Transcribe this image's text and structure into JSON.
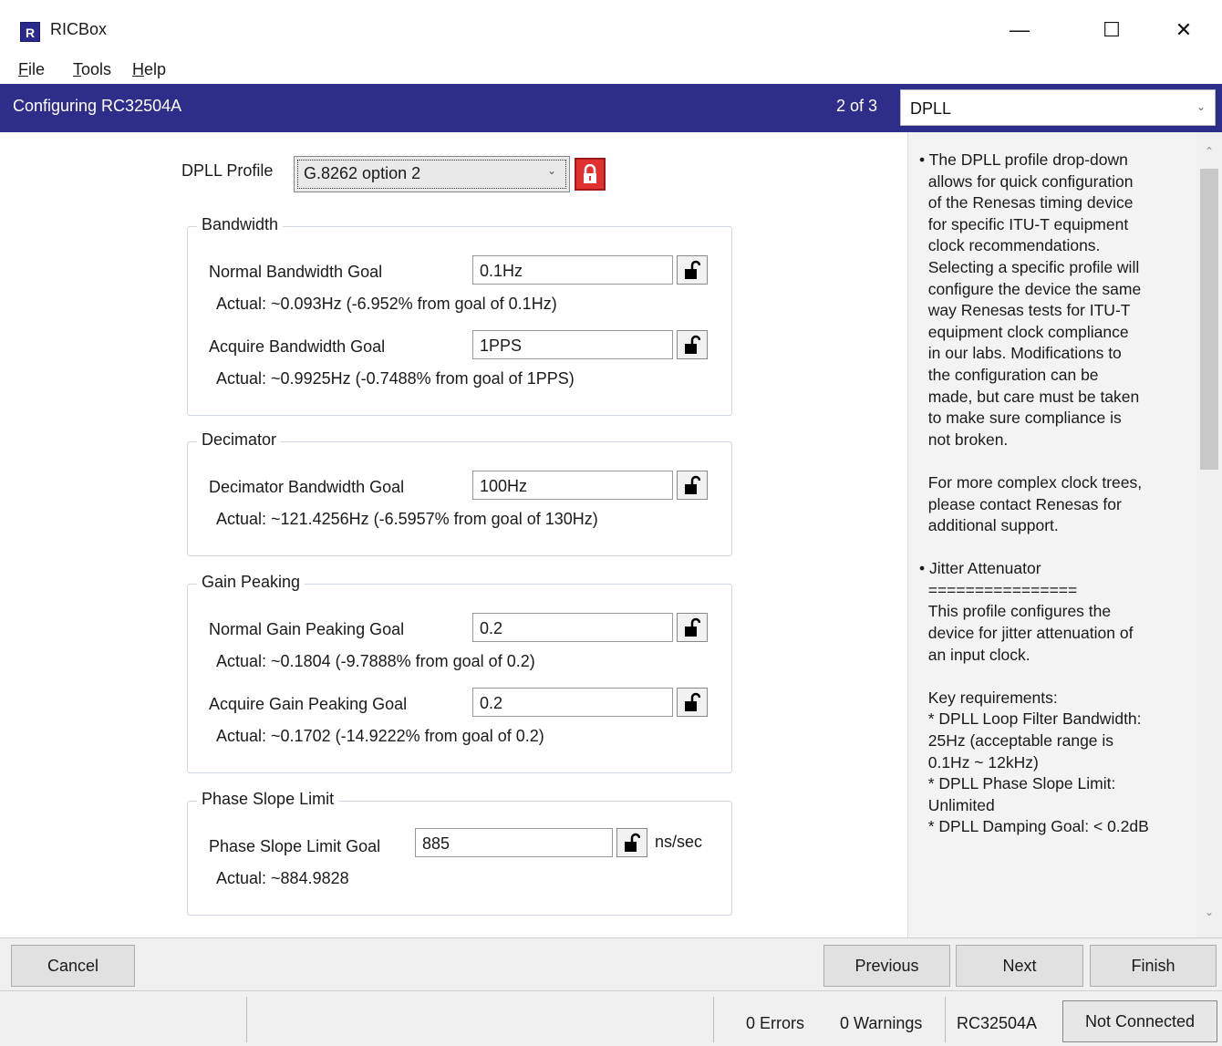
{
  "window": {
    "app_icon": "R",
    "title": "RICBox",
    "minimize": "—",
    "maximize": "☐",
    "close": "✕"
  },
  "menu": {
    "file_u": "F",
    "file_rest": "ile",
    "tools_u": "T",
    "tools_rest": "ools",
    "help_u": "H",
    "help_rest": "elp"
  },
  "header": {
    "title": "Configuring RC32504A",
    "step": "2 of 3",
    "step_select": "DPLL"
  },
  "profile": {
    "label": "DPLL Profile",
    "value": "G.8262 option 2"
  },
  "bandwidth": {
    "group": "Bandwidth",
    "normal_label": "Normal Bandwidth Goal",
    "normal_value": "0.1Hz",
    "normal_actual": "Actual:  ~0.093Hz (-6.952% from goal of 0.1Hz)",
    "acquire_label": "Acquire Bandwidth Goal",
    "acquire_value": "1PPS",
    "acquire_actual": "Actual:  ~0.9925Hz (-0.7488% from goal of 1PPS)"
  },
  "decimator": {
    "group": "Decimator",
    "label": "Decimator Bandwidth Goal",
    "value": "100Hz",
    "actual": "Actual:  ~121.4256Hz (-6.5957% from goal of 130Hz)"
  },
  "gain_peaking": {
    "group": "Gain Peaking",
    "normal_label": "Normal Gain Peaking Goal",
    "normal_value": "0.2",
    "normal_actual": "Actual:  ~0.1804 (-9.7888% from goal of 0.2)",
    "acquire_label": "Acquire Gain Peaking Goal",
    "acquire_value": "0.2",
    "acquire_actual": "Actual:  ~0.1702 (-14.9222% from goal of 0.2)"
  },
  "phase_slope": {
    "group": "Phase Slope Limit",
    "label": "Phase Slope Limit Goal",
    "value": "885",
    "unit": "ns/sec",
    "actual": "Actual:  ~884.9828"
  },
  "help": {
    "text": "• The DPLL profile drop-down\n  allows for quick configuration\n  of the Renesas timing device\n  for specific ITU-T equipment\n  clock recommendations.\n  Selecting a specific profile will\n  configure the device the same\n  way Renesas tests for ITU-T\n  equipment clock compliance\n  in our labs. Modifications to\n  the configuration can be\n  made, but care must be taken\n  to make sure compliance is\n  not broken.\n\n  For more complex clock trees,\n  please contact Renesas for\n  additional support.\n\n• Jitter Attenuator\n  ================\n  This profile configures the\n  device for jitter attenuation of\n  an input clock.\n\n  Key requirements:\n  * DPLL Loop Filter Bandwidth:\n  25Hz (acceptable range is\n  0.1Hz ~ 12kHz)\n  * DPLL Phase Slope Limit:\n  Unlimited\n  * DPLL Damping Goal: < 0.2dB"
  },
  "footer": {
    "cancel": "Cancel",
    "previous": "Previous",
    "next": "Next",
    "finish": "Finish"
  },
  "status": {
    "errors": "0 Errors",
    "warnings": "0 Warnings",
    "device": "RC32504A",
    "connection": "Not Connected"
  }
}
